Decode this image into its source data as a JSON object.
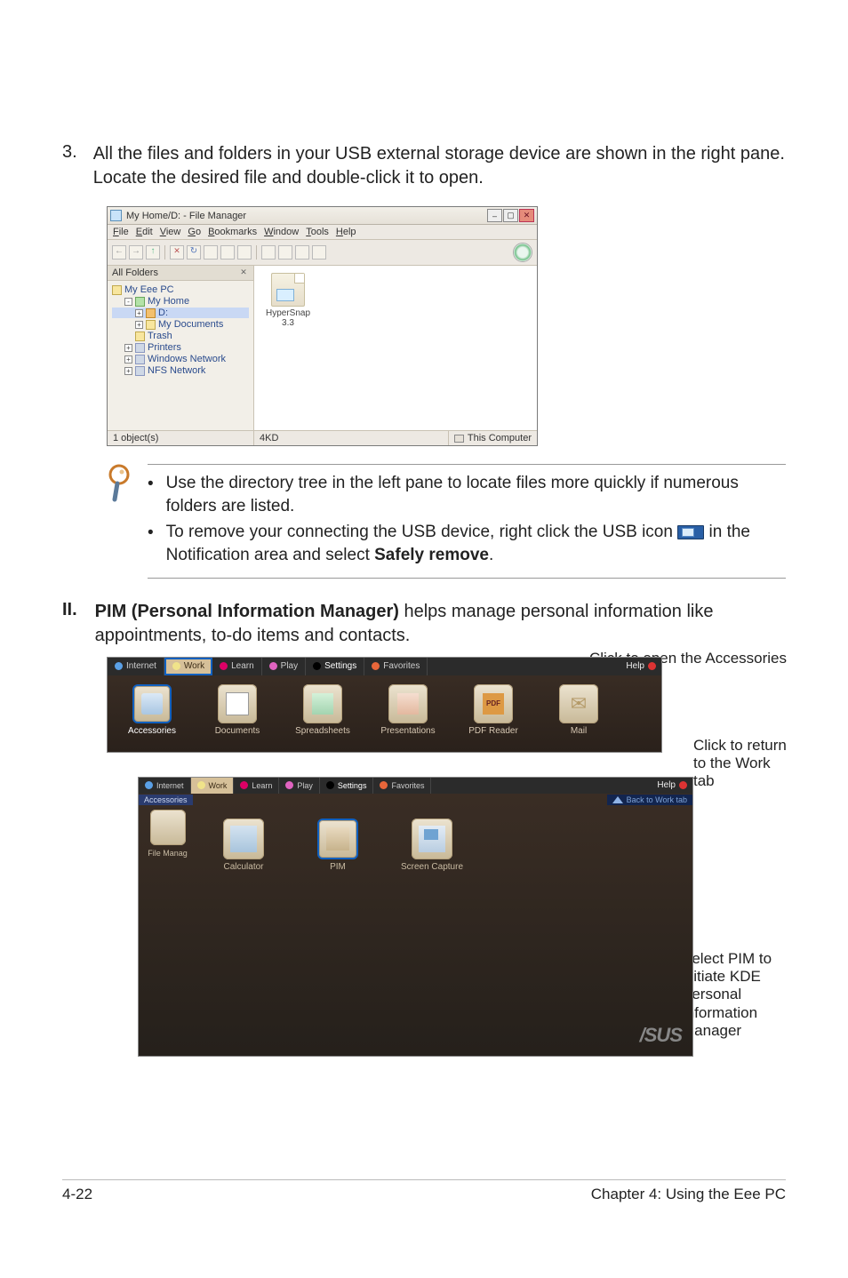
{
  "step3": {
    "number": "3.",
    "text": "All the files and folders in your USB external storage device are shown in the right pane. Locate the desired file and double-click it to open."
  },
  "fm": {
    "title": "My Home/D: - File Manager",
    "menu": [
      "File",
      "Edit",
      "View",
      "Go",
      "Bookmarks",
      "Window",
      "Tools",
      "Help"
    ],
    "left_panel_title": "All Folders",
    "tree": {
      "root": "My Eee PC",
      "home": "My Home",
      "drive": "D:",
      "docs": "My Documents",
      "trash": "Trash",
      "printers": "Printers",
      "winnet": "Windows Network",
      "nfsnet": "NFS Network"
    },
    "file": {
      "name": "HyperSnap",
      "ver": "3.3"
    },
    "status": {
      "objs": "1 object(s)",
      "size": "4KD",
      "loc": "This Computer"
    }
  },
  "tips": {
    "bullet": "•",
    "tip1": "Use the directory tree in the left pane to locate files more quickly if numerous folders are listed.",
    "tip2a": "To remove your connecting the USB device, right click the USB icon ",
    "tip2b": " in the Notification area and select ",
    "tip2c": "Safely remove",
    "tip2d": "."
  },
  "sectionII": {
    "num": "II.",
    "lead": "PIM (Personal Information Manager)",
    "rest": " helps manage personal information like appointments, to-do items and contacts."
  },
  "callouts": {
    "top": "Click to open the Accessories",
    "right1": "Click to return to the Work tab",
    "right2": "Select PIM to initiate KDE Personal Information Manager"
  },
  "desk": {
    "tabs": {
      "internet": "Internet",
      "work": "Work",
      "learn": "Learn",
      "play": "Play",
      "settings": "Settings",
      "fav": "Favorites",
      "help": "Help"
    },
    "apps": {
      "accessories": "Accessories",
      "docs": "Documents",
      "spread": "Spreadsheets",
      "present": "Presentations",
      "pdf": "PDF Reader",
      "mail": "Mail"
    },
    "sub": {
      "accessories_label": "Accessories",
      "back": "Back to Work tab",
      "filemgr": "File Manag",
      "calc": "Calculator",
      "pim": "PIM",
      "screen": "Screen Capture"
    },
    "asus": "/SUS"
  },
  "footer": {
    "left": "4-22",
    "right": "Chapter 4: Using the Eee PC"
  }
}
